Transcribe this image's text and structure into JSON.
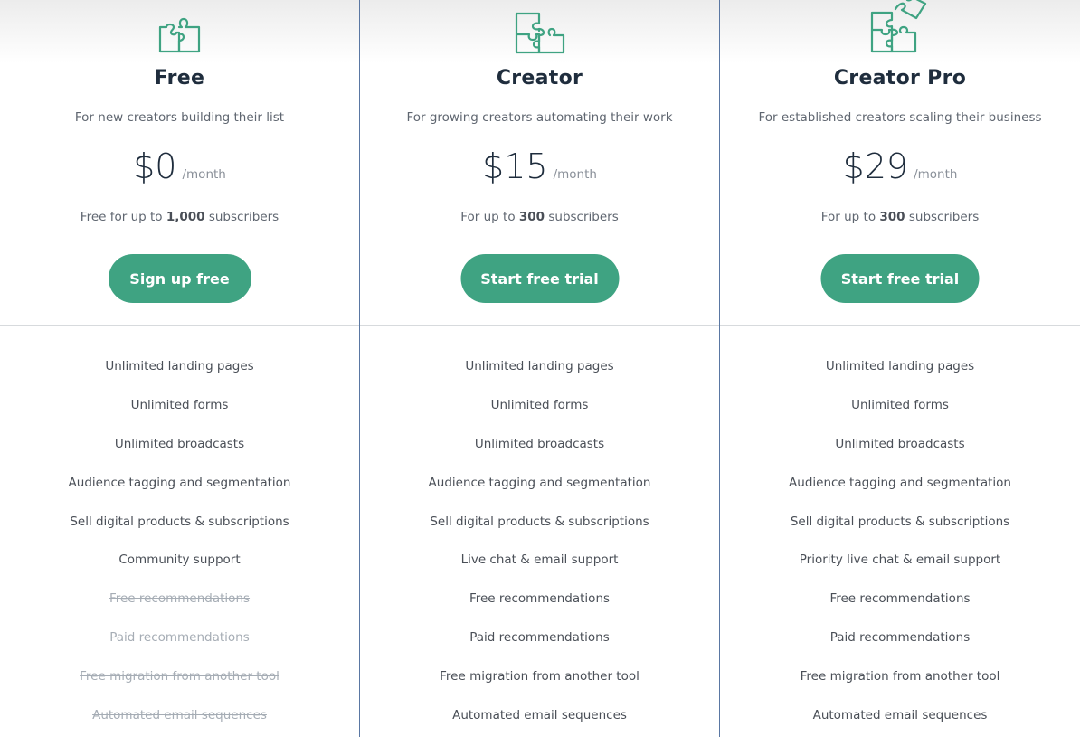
{
  "plans": [
    {
      "name": "Free",
      "icon": "puzzle-2-pieces-icon",
      "description": "For new creators building their list",
      "price": "$0",
      "period": "/month",
      "subscribers_prefix": "Free for up to ",
      "subscribers_count": "1,000",
      "subscribers_suffix": " subscribers",
      "cta_label": "Sign up free",
      "features": [
        {
          "label": "Unlimited landing pages",
          "included": true
        },
        {
          "label": "Unlimited forms",
          "included": true
        },
        {
          "label": "Unlimited broadcasts",
          "included": true
        },
        {
          "label": "Audience tagging and segmentation",
          "included": true
        },
        {
          "label": "Sell digital products & subscriptions",
          "included": true
        },
        {
          "label": "Community support",
          "included": true
        },
        {
          "label": "Free recommendations",
          "included": false
        },
        {
          "label": "Paid recommendations",
          "included": false
        },
        {
          "label": "Free migration from another tool",
          "included": false
        },
        {
          "label": "Automated email sequences",
          "included": false
        }
      ]
    },
    {
      "name": "Creator",
      "icon": "puzzle-3-pieces-icon",
      "description": "For growing creators automating their work",
      "price": "$15",
      "period": "/month",
      "subscribers_prefix": "For up to ",
      "subscribers_count": "300",
      "subscribers_suffix": " subscribers",
      "cta_label": "Start free trial",
      "features": [
        {
          "label": "Unlimited landing pages",
          "included": true
        },
        {
          "label": "Unlimited forms",
          "included": true
        },
        {
          "label": "Unlimited broadcasts",
          "included": true
        },
        {
          "label": "Audience tagging and segmentation",
          "included": true
        },
        {
          "label": "Sell digital products & subscriptions",
          "included": true
        },
        {
          "label": "Live chat & email support",
          "included": true
        },
        {
          "label": "Free recommendations",
          "included": true
        },
        {
          "label": "Paid recommendations",
          "included": true
        },
        {
          "label": "Free migration from another tool",
          "included": true
        },
        {
          "label": "Automated email sequences",
          "included": true
        }
      ]
    },
    {
      "name": "Creator Pro",
      "icon": "puzzle-4-pieces-icon",
      "description": "For established creators scaling their business",
      "price": "$29",
      "period": "/month",
      "subscribers_prefix": "For up to ",
      "subscribers_count": "300",
      "subscribers_suffix": " subscribers",
      "cta_label": "Start free trial",
      "features": [
        {
          "label": "Unlimited landing pages",
          "included": true
        },
        {
          "label": "Unlimited forms",
          "included": true
        },
        {
          "label": "Unlimited broadcasts",
          "included": true
        },
        {
          "label": "Audience tagging and segmentation",
          "included": true
        },
        {
          "label": "Sell digital products & subscriptions",
          "included": true
        },
        {
          "label": "Priority live chat & email support",
          "included": true
        },
        {
          "label": "Free recommendations",
          "included": true
        },
        {
          "label": "Paid recommendations",
          "included": true
        },
        {
          "label": "Free migration from another tool",
          "included": true
        },
        {
          "label": "Automated email sequences",
          "included": true
        }
      ]
    }
  ],
  "colors": {
    "accent": "#3fa382",
    "heading": "#1f2d3d",
    "divider_vertical": "#5a77a3",
    "divider_horizontal": "#d7dadd",
    "disabled_text": "#a6adb5"
  }
}
